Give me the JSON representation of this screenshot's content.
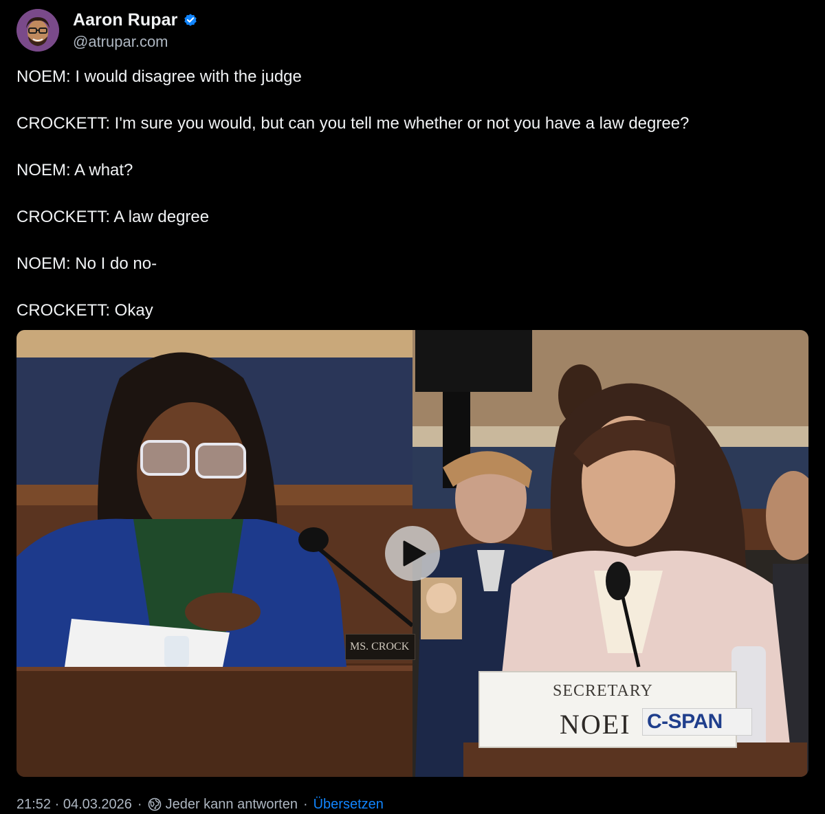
{
  "author": {
    "display_name": "Aaron Rupar",
    "handle": "@atrupar.com",
    "verified": true,
    "avatar_icon": "avatar-icon"
  },
  "post": {
    "lines": [
      "NOEM: I would disagree with the judge",
      "CROCKETT: I'm sure you would, but can you tell me whether or not you have a law degree?",
      "NOEM: A what?",
      "CROCKETT: A law degree",
      "NOEM: No I do no-",
      "CROCKETT: Okay"
    ]
  },
  "media": {
    "type": "video",
    "left_nameplate": "MS. CROCK",
    "right_nameplate_title": "SECRETARY",
    "right_nameplate_name": "NOEI",
    "watermark": "C-SPAN",
    "play_icon": "play-icon"
  },
  "footer": {
    "timestamp": "21:52 · 04.03.2026",
    "separator": "·",
    "reply_setting": "Jeder kann antworten",
    "translate": "Übersetzen"
  },
  "colors": {
    "background": "#000000",
    "text": "#f1f3f5",
    "muted": "#aeb7c2",
    "link": "#1185fe",
    "verified": "#1185fe"
  }
}
